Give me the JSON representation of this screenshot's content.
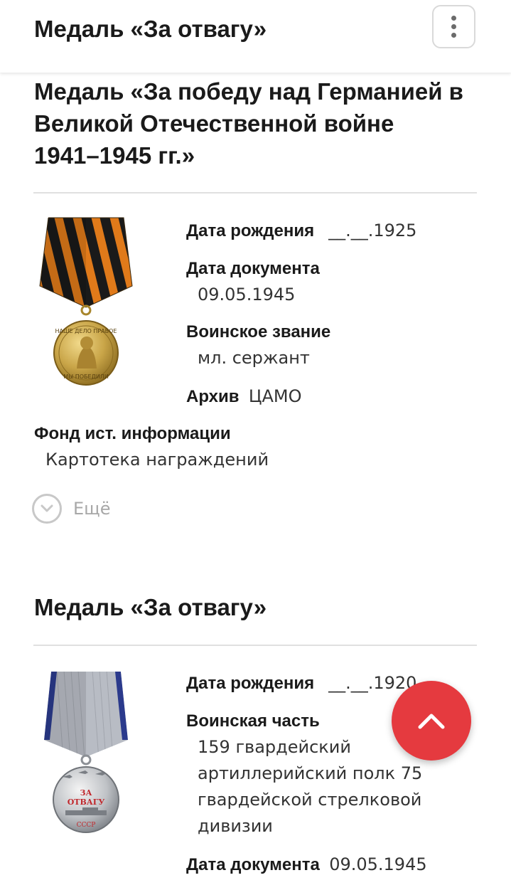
{
  "header": {
    "title": "Медаль «За отвагу»",
    "menu_icon": "more-vertical-icon"
  },
  "awards": [
    {
      "title_lines": [
        "Медаль «За победу над Германией в",
        "Великой Отечественной войне",
        "1941–1945 гг.»"
      ],
      "medal_icon": "medal-victory-over-germany-icon",
      "fields": {
        "birth_date": {
          "label": "Дата рождения",
          "value": "__.__.1925"
        },
        "doc_date": {
          "label": "Дата документа",
          "value": "09.05.1945"
        },
        "rank": {
          "label": "Воинское звание",
          "value": "мл. сержант"
        },
        "archive": {
          "label": "Архив",
          "value": "ЦАМО"
        },
        "fund": {
          "label": "Фонд ист. информации",
          "value": "Картотека награждений"
        }
      },
      "medal_text": {
        "top": "НАШЕ ДЕЛО ПРАВОЕ",
        "bottom": "МЫ ПОБЕДИЛИ"
      },
      "more_label": "Ещё"
    },
    {
      "title": "Медаль «За отвагу»",
      "medal_icon": "medal-for-courage-icon",
      "fields": {
        "birth_date": {
          "label": "Дата рождения",
          "value": "__.__.1920"
        },
        "unit": {
          "label": "Воинская часть",
          "value_lines": [
            "159 гвардейский",
            "артиллерийский полк 75",
            "гвардейской стрелковой",
            "дивизии"
          ]
        },
        "doc_date": {
          "label": "Дата документа",
          "value": "09.05.1945"
        }
      },
      "medal_text": {
        "line1": "ЗА",
        "line2": "ОТВАГУ",
        "line3": "СССР"
      }
    }
  ],
  "fab": {
    "icon": "chevron-up-icon",
    "color": "#e53a3f"
  },
  "colors": {
    "divider": "#e0e0e0",
    "more_muted": "#a8a8a8",
    "ribbon_orange": "#e07a1a",
    "ribbon_black": "#1a1a1a",
    "ribbon_grey": "#b8bcc4",
    "ribbon_blue": "#2b3a8c"
  }
}
